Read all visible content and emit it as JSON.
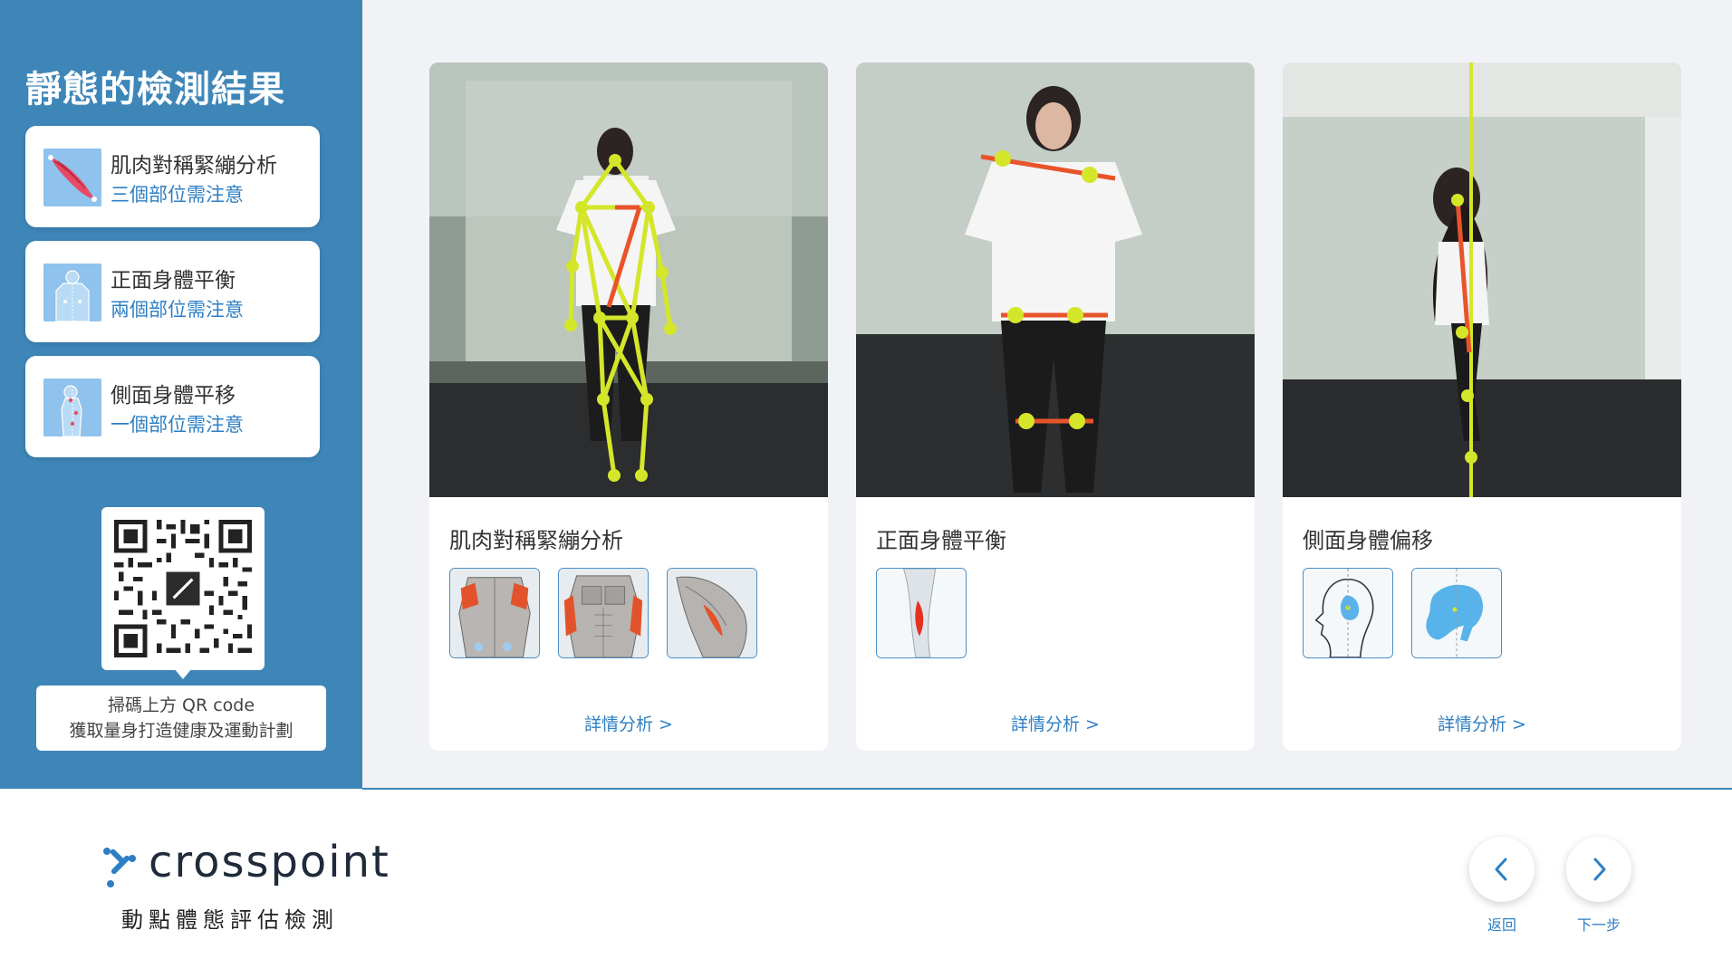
{
  "sidebar": {
    "title": "靜態的檢測結果",
    "cards": [
      {
        "title": "肌肉對稱緊繃分析",
        "sub": "三個部位需注意",
        "icon": "muscle-icon"
      },
      {
        "title": "正面身體平衡",
        "sub": "兩個部位需注意",
        "icon": "front-body-icon"
      },
      {
        "title": "側面身體平移",
        "sub": "一個部位需注意",
        "icon": "side-body-icon"
      }
    ],
    "qr_note_line1": "掃碼上方 QR code",
    "qr_note_line2": "獲取量身打造健康及運動計劃"
  },
  "analysis": [
    {
      "title": "肌肉對稱緊繃分析",
      "link": "詳情分析 >"
    },
    {
      "title": "正面身體平衡",
      "link": "詳情分析 >"
    },
    {
      "title": "側面身體偏移",
      "link": "詳情分析 >"
    }
  ],
  "footer": {
    "brand": "crosspoint",
    "brand_sub": "動點體態評估檢測",
    "back_label": "返回",
    "next_label": "下一步"
  },
  "colors": {
    "sidebar": "#3e86b8",
    "accent": "#2d7fc4",
    "skeleton": "#d4e62a",
    "highlight": "#e8542a"
  }
}
